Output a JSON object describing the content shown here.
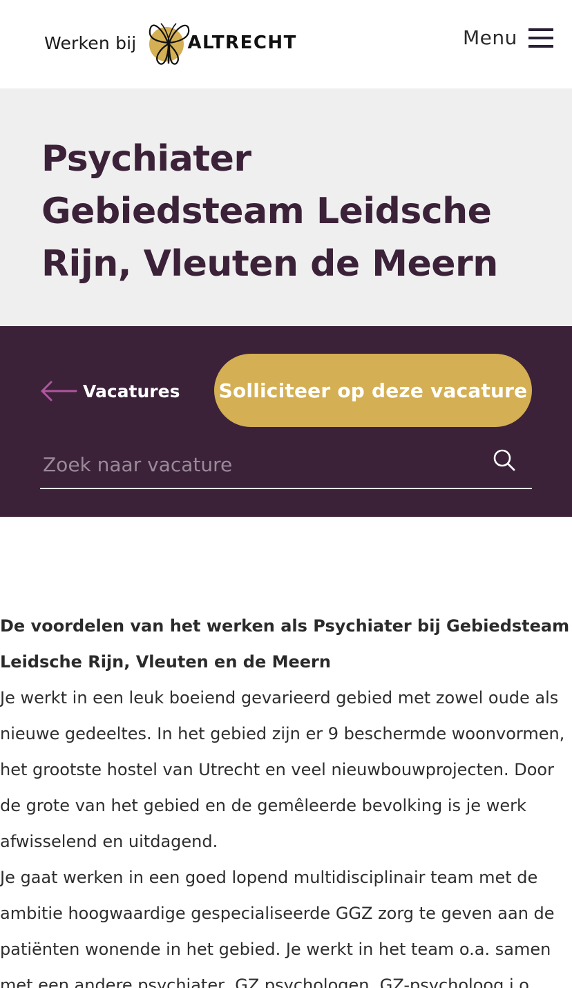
{
  "header": {
    "logo_prefix": "Werken bij",
    "logo_word": "ALTRECHT",
    "logo_icon": "butterfly-logo-icon",
    "menu_label": "Menu",
    "menu_icon": "hamburger-icon"
  },
  "hero": {
    "title": "Psychiater Gebiedsteam Leidsche Rijn, Vleuten de Meern"
  },
  "actions": {
    "back_label": "Vacatures",
    "back_icon": "arrow-left-icon",
    "apply_label": "Solliciteer op deze vacature",
    "search_placeholder": "Zoek naar vacature",
    "search_value": "",
    "search_icon": "search-icon"
  },
  "content": {
    "heading": "De voordelen van het werken als Psychiater bij Gebiedsteam Leidsche Rijn, Vleuten en de Meern",
    "paragraph_1": "Je werkt in een leuk boeiend gevarieerd gebied  met zowel oude als nieuwe gedeeltes. In het gebied zijn er 9 beschermde woonvormen, het grootste hostel van Utrecht en veel nieuwbouwprojecten.  Door de grote van het gebied en de gemêleerde bevolking is je werk afwisselend en uitdagend.",
    "paragraph_2": "Je gaat werken in een goed lopend multidisciplinair team met de ambitie hoogwaardige gespecialiseerde GGZ zorg te geven aan de patiënten wonende in het gebied. Je werkt in het team o.a. samen met een andere psychiater,  GZ psychologen, GZ-psycholoog i.o., "
  },
  "colors": {
    "brand_purple": "#3b2239",
    "title_purple": "#3b2238",
    "accent_gold": "#d4af54",
    "arrow_pink": "#b0559e",
    "band_grey": "#efefef"
  }
}
